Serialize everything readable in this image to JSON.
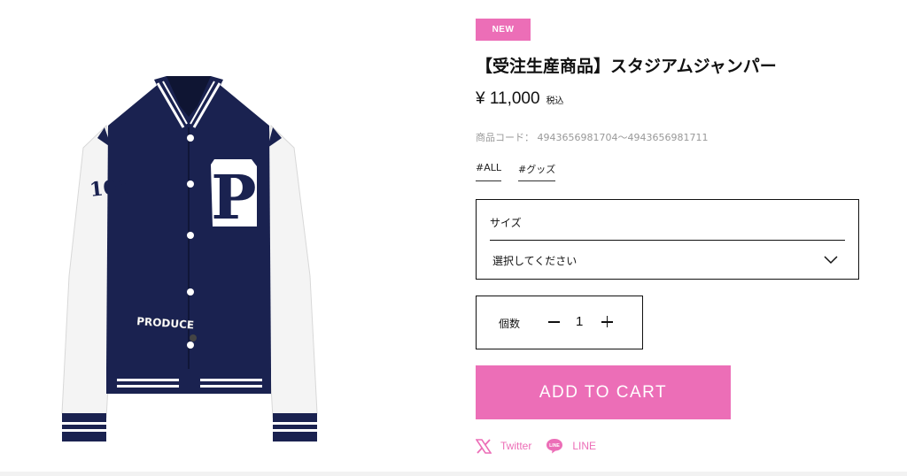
{
  "product": {
    "badge": "NEW",
    "title": "【受注生産商品】スタジアムジャンパー",
    "price": "¥ 11,000",
    "tax_label": "税込",
    "code_label": "商品コード：",
    "code_value": "4943656981704〜4943656981711",
    "tags": [
      "#ALL",
      "#グッズ"
    ],
    "image_text": {
      "chest_letter": "P",
      "sleeve_text": "101",
      "patch_text": "PRODUCE"
    }
  },
  "size_select": {
    "label": "サイズ",
    "value": "選択してください"
  },
  "quantity": {
    "label": "個数",
    "value": "1"
  },
  "cart_button": {
    "label": "ADD TO CART"
  },
  "share": {
    "twitter": "Twitter",
    "line": "LINE",
    "line_icon_text": "LINE"
  },
  "colors": {
    "accent": "#ec6eb7",
    "jacket_navy": "#1a2250",
    "sleeve_white": "#f4f4f4"
  },
  "icons": {
    "select_arrow": "chevron-down-icon",
    "qty_minus": "minus-icon",
    "qty_plus": "plus-icon",
    "twitter": "x-logo-icon",
    "line": "line-logo-icon"
  }
}
